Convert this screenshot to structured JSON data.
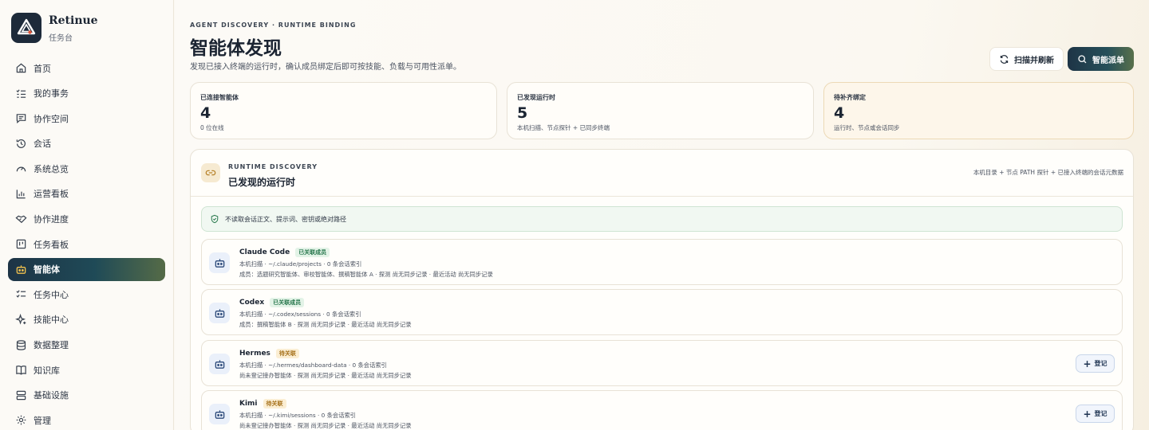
{
  "brand": {
    "name": "Retinue",
    "subtitle": "任务台"
  },
  "sidebar": {
    "items": [
      {
        "label": "首页",
        "icon": "home-icon"
      },
      {
        "label": "我的事务",
        "icon": "list-icon"
      },
      {
        "label": "协作空间",
        "icon": "chat-icon"
      },
      {
        "label": "会话",
        "icon": "history-icon"
      },
      {
        "label": "系统总览",
        "icon": "gauge-icon"
      },
      {
        "label": "运营看板",
        "icon": "bar-chart-icon"
      },
      {
        "label": "协作进度",
        "icon": "handshake-icon"
      },
      {
        "label": "任务看板",
        "icon": "kanban-icon"
      },
      {
        "label": "智能体",
        "icon": "bot-icon",
        "active": true
      },
      {
        "label": "任务中心",
        "icon": "checklist-icon"
      },
      {
        "label": "技能中心",
        "icon": "sparkles-icon"
      },
      {
        "label": "数据整理",
        "icon": "database-icon"
      },
      {
        "label": "知识库",
        "icon": "book-icon"
      },
      {
        "label": "基础设施",
        "icon": "server-icon"
      },
      {
        "label": "管理",
        "icon": "settings-icon"
      }
    ]
  },
  "header": {
    "eyebrow": "AGENT DISCOVERY · RUNTIME BINDING",
    "title": "智能体发现",
    "description": "发现已接入终端的运行时，确认成员绑定后即可按技能、负载与可用性派单。",
    "scan_button": "扫描并刷新",
    "dispatch_button": "智能派单"
  },
  "stats": [
    {
      "label": "已连接智能体",
      "value": "4",
      "note": "0 位在线"
    },
    {
      "label": "已发现运行时",
      "value": "5",
      "note": "本机扫描、节点探针 + 已同步终端"
    },
    {
      "label": "待补齐绑定",
      "value": "4",
      "note": "运行时、节点或会话同步"
    }
  ],
  "panel": {
    "eyebrow": "RUNTIME DISCOVERY",
    "title": "已发现的运行时",
    "meta": "本机目录 + 节点 PATH 探针 + 已接入终端的会话元数据",
    "notice": "不读取会话正文、提示词、密钥或绝对路径"
  },
  "runtimes": [
    {
      "name": "Claude Code",
      "badge": "已关联成员",
      "status": "linked",
      "line1": "本机扫描 · ~/.claude/projects · 0 条会话索引",
      "line2": "成员：选题研究智能体、审校智能体、撰稿智能体 A · 探测 尚无同步记录 · 最近活动 尚无同步记录",
      "action": ""
    },
    {
      "name": "Codex",
      "badge": "已关联成员",
      "status": "linked",
      "line1": "本机扫描 · ~/.codex/sessions · 0 条会话索引",
      "line2": "成员：撰稿智能体 B · 探测 尚无同步记录 · 最近活动 尚无同步记录",
      "action": ""
    },
    {
      "name": "Hermes",
      "badge": "待关联",
      "status": "pending",
      "line1": "本机扫描 · ~/.hermes/dashboard-data · 0 条会话索引",
      "line2": "尚未登记接办智能体 · 探测 尚无同步记录 · 最近活动 尚无同步记录",
      "action": "登记"
    },
    {
      "name": "Kimi",
      "badge": "待关联",
      "status": "pending",
      "line1": "本机扫描 · ~/.kimi/sessions · 0 条会话索引",
      "line2": "尚未登记接办智能体 · 探测 尚无同步记录 · 最近活动 尚无同步记录",
      "action": "登记"
    }
  ]
}
